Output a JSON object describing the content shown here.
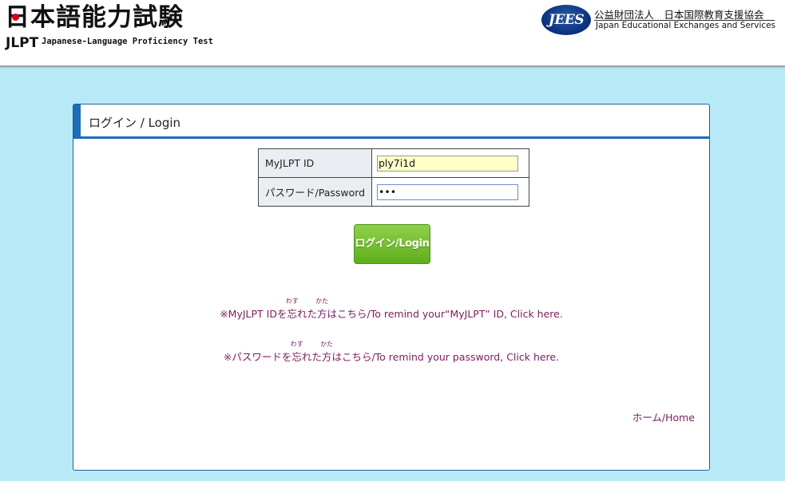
{
  "header": {
    "logo": {
      "title": "日本語能力試験",
      "mark": "JLPT",
      "subtitle": "Japanese-Language Proficiency Test"
    },
    "org": {
      "badge": "JEES",
      "name_jp": "公益財団法人　日本国際教育支援協会",
      "name_en": "Japan Educational Exchanges and Services"
    }
  },
  "login": {
    "title": "ログイン / Login",
    "fields": {
      "id_label": "MyJLPT ID",
      "id_value": "ply7i1d",
      "password_label": "パスワード/Password",
      "password_value": "•••"
    },
    "button": "ログイン/Login"
  },
  "links": {
    "remind_id": {
      "before": "※MyJLPT IDを",
      "kanji1": "忘",
      "kanji1_ruby": "わす",
      "middle": "れた",
      "kanji2": "方",
      "kanji2_ruby": "かた",
      "after": "はこちら/To remind your“MyJLPT” ID, Click here."
    },
    "remind_password": {
      "before": "※パスワードを",
      "kanji1": "忘",
      "kanji1_ruby": "わす",
      "middle": "れた",
      "kanji2": "方",
      "kanji2_ruby": "かた",
      "after": "はこちら/To remind your password, Click here."
    },
    "home": "ホーム/Home"
  },
  "colors": {
    "page_background": "#b7eaf6",
    "accent_blue": "#1e6bb8",
    "button_green": "#6cbf26",
    "link_color": "#7a1d5f"
  }
}
